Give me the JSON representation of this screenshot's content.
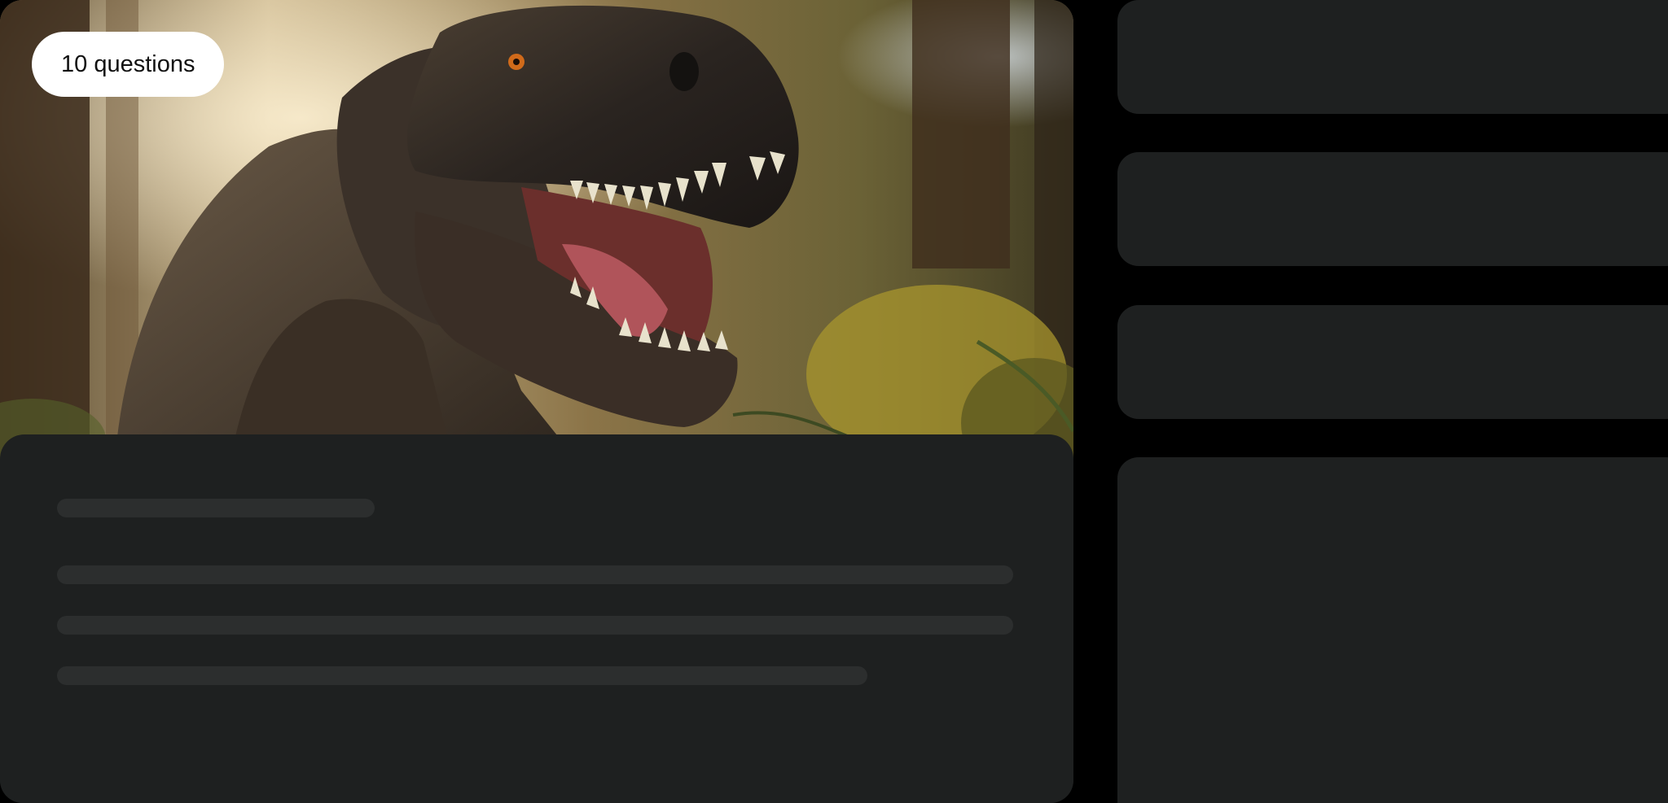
{
  "quiz": {
    "question_count_label": "10 questions"
  },
  "hero_image": {
    "description_icon": "dinosaur-image"
  },
  "colors": {
    "background": "#000000",
    "card": "#1e2020",
    "skeleton": "#2c2e2e",
    "badge_bg": "#ffffff",
    "badge_text": "#111111"
  }
}
